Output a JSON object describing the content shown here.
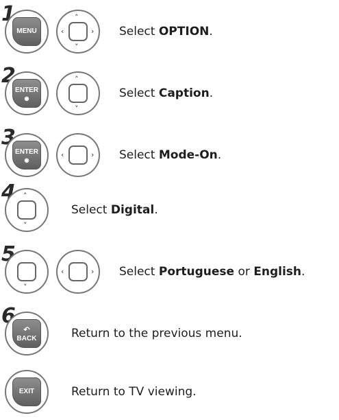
{
  "steps": [
    {
      "num": "1",
      "buttons": [
        "menu-button",
        "nav-pad"
      ],
      "pre": "Select ",
      "bold": "OPTION",
      "post": "."
    },
    {
      "num": "2",
      "buttons": [
        "enter-button",
        "up-down-pad"
      ],
      "pre": "Select ",
      "bold": "Caption",
      "post": "."
    },
    {
      "num": "3",
      "buttons": [
        "enter-button",
        "left-right-pad"
      ],
      "pre": "Select ",
      "bold": "Mode-On",
      "post": "."
    },
    {
      "num": "4",
      "buttons": [
        "up-down-pad"
      ],
      "pre": "Select ",
      "bold": "Digital",
      "post": "."
    },
    {
      "num": "5",
      "buttons": [
        "down-pad",
        "left-right-pad"
      ],
      "pre": "Select ",
      "bold": "Portuguese",
      "mid": " or ",
      "bold2": "English",
      "post": "."
    },
    {
      "num": "6",
      "buttons": [
        "back-button"
      ],
      "pre": "Return to the previous menu.",
      "bold": "",
      "post": ""
    },
    {
      "num": "",
      "buttons": [
        "exit-button"
      ],
      "pre": "Return to TV viewing.",
      "bold": "",
      "post": ""
    }
  ],
  "buttons": {
    "menu": "MENU",
    "enter": "ENTER",
    "back": "BACK",
    "exit": "EXIT",
    "arrow_up": "˄",
    "arrow_down": "˅",
    "arrow_left": "‹",
    "arrow_right": "›",
    "enter_dot": "◉",
    "back_glyph": "↶"
  }
}
